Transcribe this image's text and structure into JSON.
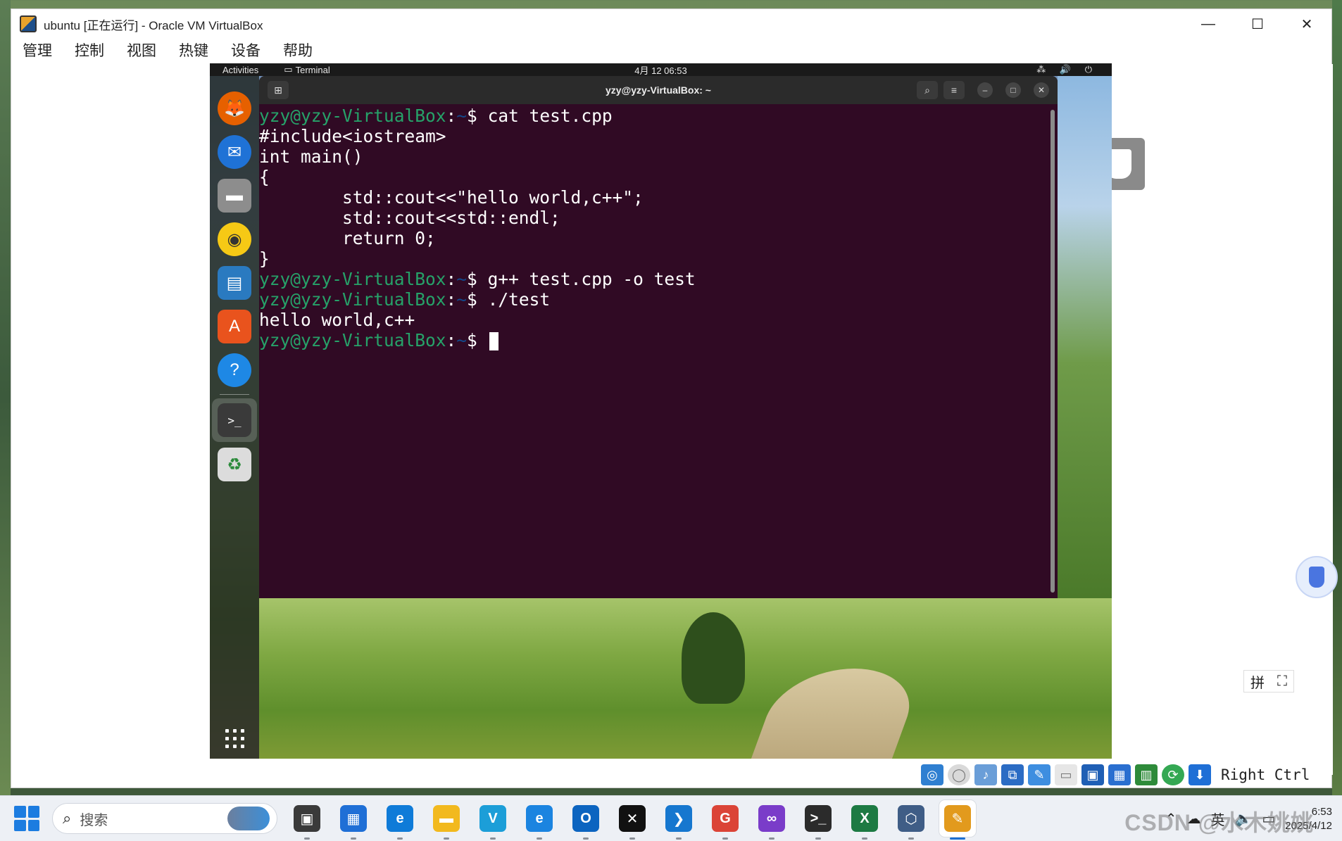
{
  "window": {
    "title": "ubuntu [正在运行] - Oracle VM VirtualBox",
    "controls": {
      "minimize": "—",
      "maximize": "☐",
      "close": "✕"
    }
  },
  "menu": [
    "管理",
    "控制",
    "视图",
    "热键",
    "设备",
    "帮助"
  ],
  "guest": {
    "topbar": {
      "activities": "Activities",
      "app": "Terminal",
      "clock": "4月 12  06:53",
      "tray": "⁂ 🔊 ⏻"
    },
    "dock": [
      {
        "name": "firefox-icon",
        "color": "#e66000"
      },
      {
        "name": "thunderbird-icon",
        "color": "#1f72d6"
      },
      {
        "name": "files-icon",
        "color": "#8d8d8d"
      },
      {
        "name": "rhythmbox-icon",
        "color": "#f6c915"
      },
      {
        "name": "libreoffice-writer-icon",
        "color": "#2a7ac0"
      },
      {
        "name": "software-store-icon",
        "color": "#e9531d"
      },
      {
        "name": "help-icon",
        "color": "#1e88e5"
      },
      {
        "name": "terminal-icon",
        "color": "#3a3a3a"
      },
      {
        "name": "trash-icon",
        "color": "#dcdcdc"
      }
    ],
    "terminal": {
      "title": "yzy@yzy-VirtualBox: ~",
      "prompt_user": "yzy@yzy-VirtualBox",
      "prompt_path": "~",
      "lines": [
        {
          "type": "cmd",
          "text": "cat test.cpp"
        },
        {
          "type": "out",
          "text": "#include<iostream>"
        },
        {
          "type": "out",
          "text": "int main()"
        },
        {
          "type": "out",
          "text": "{"
        },
        {
          "type": "out",
          "text": "        std::cout<<\"hello world,c++\";"
        },
        {
          "type": "out",
          "text": "        std::cout<<std::endl;"
        },
        {
          "type": "out",
          "text": "        return 0;"
        },
        {
          "type": "out",
          "text": "}"
        },
        {
          "type": "cmd",
          "text": "g++ test.cpp -o test"
        },
        {
          "type": "cmd",
          "text": "./test"
        },
        {
          "type": "out",
          "text": "hello world,c++"
        },
        {
          "type": "cmd",
          "text": ""
        }
      ]
    }
  },
  "vbox_status": {
    "host_key": "Right Ctrl",
    "icons": [
      "hard-disk-icon",
      "optical-drive-icon",
      "audio-icon",
      "network-icon",
      "usb-icon",
      "shared-folder-icon",
      "display-icon",
      "recording-icon",
      "cpu-icon",
      "mouse-integration-icon",
      "keyboard-icon"
    ]
  },
  "ime": {
    "mode": "拼",
    "extra": "⛶"
  },
  "taskbar": {
    "search_placeholder": "搜索",
    "apps": [
      {
        "name": "task-view-icon",
        "color": "#3a3a3a",
        "glyph": "▣"
      },
      {
        "name": "microsoft-store-icon",
        "color": "#1f6fd6",
        "glyph": "▦"
      },
      {
        "name": "edge-icon",
        "color": "#0f7bd8",
        "glyph": "e"
      },
      {
        "name": "file-explorer-icon",
        "color": "#f2b91e",
        "glyph": "▬"
      },
      {
        "name": "app-v-icon",
        "color": "#1c9ed8",
        "glyph": "V"
      },
      {
        "name": "edge-ai-icon",
        "color": "#1b84e0",
        "glyph": "e"
      },
      {
        "name": "outlook-icon",
        "color": "#0c64c0",
        "glyph": "O"
      },
      {
        "name": "capcut-icon",
        "color": "#111111",
        "glyph": "✕"
      },
      {
        "name": "vscode-icon",
        "color": "#1677cf",
        "glyph": "❯"
      },
      {
        "name": "chrome-icon",
        "color": "#db4437",
        "glyph": "G"
      },
      {
        "name": "visual-studio-icon",
        "color": "#7a3cc9",
        "glyph": "∞"
      },
      {
        "name": "windows-terminal-icon",
        "color": "#2b2b2b",
        "glyph": ">_"
      },
      {
        "name": "excel-icon",
        "color": "#1d7a43",
        "glyph": "X"
      },
      {
        "name": "virtualbox-manager-icon",
        "color": "#3f5d86",
        "glyph": "⬡"
      },
      {
        "name": "virtualbox-vm-icon",
        "color": "#e29a1d",
        "glyph": "✎"
      }
    ],
    "tray": {
      "clock_time": "6:53",
      "clock_date": "2025/4/12"
    },
    "watermark": "CSDN @水木姚姚"
  }
}
